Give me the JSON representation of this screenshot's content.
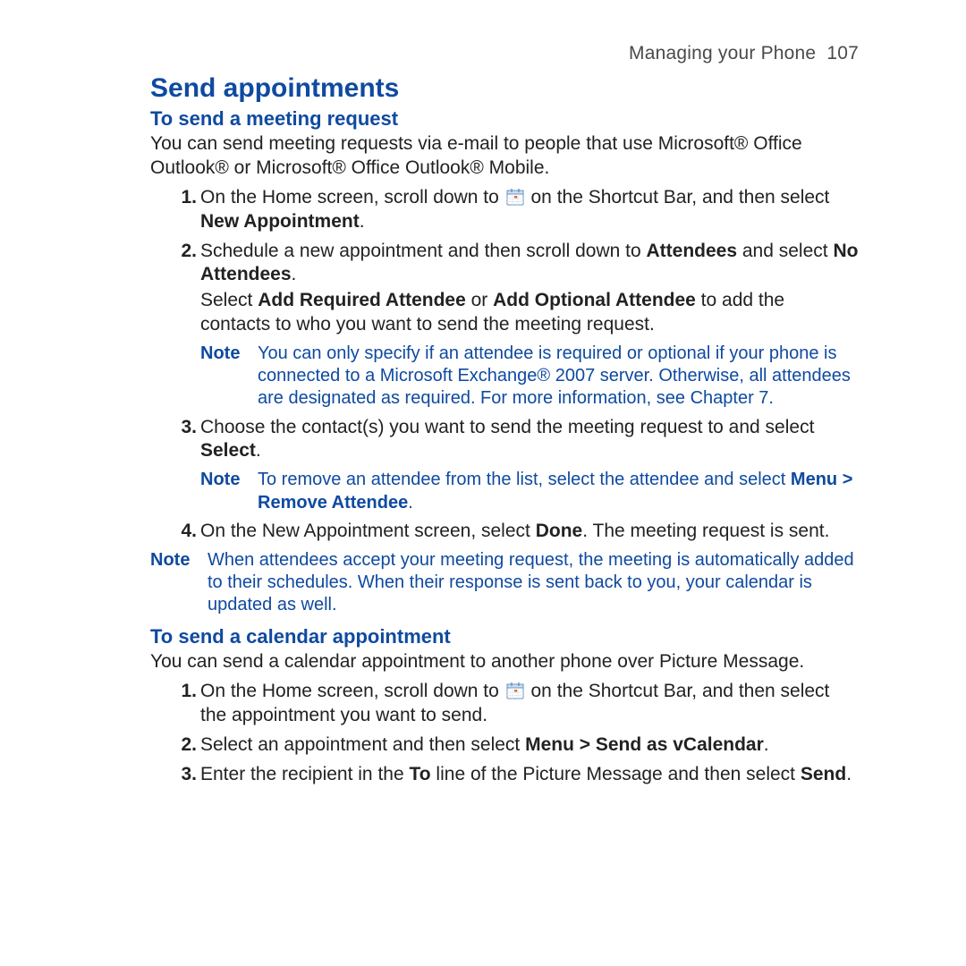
{
  "header": {
    "running": "Managing your Phone",
    "page_no": "107"
  },
  "section_title": "Send appointments",
  "sub1": {
    "title": "To send a meeting request",
    "intro": "You can send meeting requests via e-mail to people that use Microsoft® Office Outlook® or Microsoft® Office Outlook® Mobile.",
    "steps": {
      "s1": {
        "num": "1.",
        "pre": "On the Home screen, scroll down to ",
        "post": " on the Shortcut Bar, and then select ",
        "bold": "New Appointment",
        "tail": "."
      },
      "s2": {
        "num": "2.",
        "line1_pre": "Schedule a new appointment and then scroll down to ",
        "line1_b1": "Attendees",
        "line1_mid": " and select ",
        "line1_b2": "No Attendees",
        "line1_tail": ".",
        "line2_pre": "Select ",
        "line2_b1": "Add Required Attendee",
        "line2_mid": " or ",
        "line2_b2": "Add Optional Attendee",
        "line2_post": " to add the contacts to who you want to send the meeting request."
      },
      "s3": {
        "num": "3.",
        "pre": "Choose the contact(s) you want to send the meeting request to and select ",
        "bold": "Select",
        "tail": "."
      },
      "s4": {
        "num": "4.",
        "pre": "On the New Appointment screen, select ",
        "bold": "Done",
        "tail": ". The meeting request is sent."
      }
    },
    "note_a": {
      "label": "Note",
      "text": "You can only specify if an attendee is required or optional if your phone is connected to a Microsoft Exchange® 2007 server. Otherwise, all attendees are designated as required. For more information, see Chapter 7."
    },
    "note_b": {
      "label": "Note",
      "pre": "To remove an attendee from the list, select the attendee and select ",
      "bold": "Menu > Remove Attendee",
      "tail": "."
    },
    "note_c": {
      "label": "Note",
      "text": "When attendees accept your meeting request, the meeting is automatically added to their schedules. When their response is sent back to you, your calendar is updated as well."
    }
  },
  "sub2": {
    "title": "To send a calendar appointment",
    "intro": "You can send a calendar appointment to another phone over Picture Message.",
    "steps": {
      "s1": {
        "num": "1.",
        "pre": "On the Home screen, scroll down to ",
        "post": " on the Shortcut Bar, and then select the appointment you want to send."
      },
      "s2": {
        "num": "2.",
        "pre": "Select an appointment and then select ",
        "bold": "Menu > Send as vCalendar",
        "tail": "."
      },
      "s3": {
        "num": "3.",
        "pre": "Enter the recipient in the ",
        "b1": "To",
        "mid": " line of the Picture Message and then select ",
        "b2": "Send",
        "tail": "."
      }
    }
  }
}
